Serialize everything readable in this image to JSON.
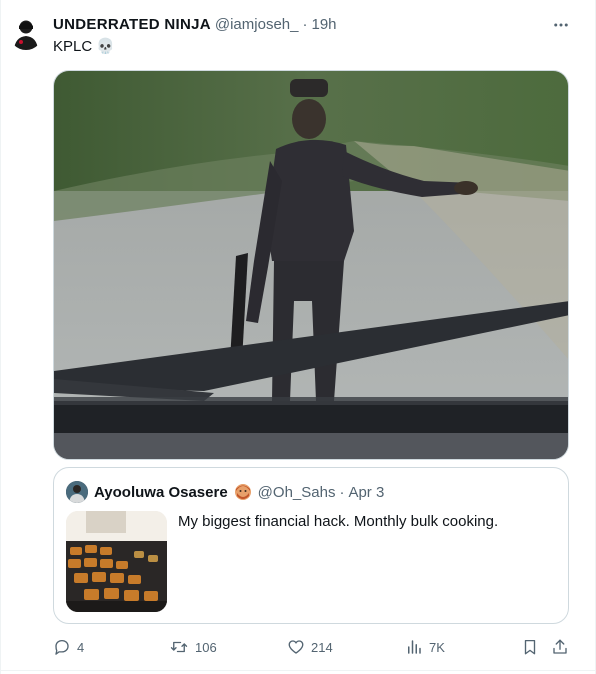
{
  "tweet": {
    "name": "UNDERRATED NINJA",
    "handle": "@iamjoseh_",
    "separator": "·",
    "time": "19h",
    "text": "KPLC",
    "emoji": "💀"
  },
  "media": {
    "alt": "Police officer pointing at the road, seen through a car windshield",
    "wiper_color": "#2b2e33"
  },
  "quote": {
    "name": "Ayooluwa Osasere",
    "handle": "@Oh_Sahs",
    "separator": "·",
    "date": "Apr 3",
    "text": "My biggest financial hack. Monthly bulk cooking."
  },
  "actions": {
    "replies": "4",
    "retweets": "106",
    "likes": "214",
    "views": "7K"
  },
  "icons": {
    "more": "more-icon",
    "reply": "reply-icon",
    "retweet": "retweet-icon",
    "like": "like-icon",
    "views": "views-icon",
    "bookmark": "bookmark-icon",
    "share": "share-icon"
  },
  "colors": {
    "text": "#0f1419",
    "secondary": "#536471",
    "border": "#cfd9de"
  }
}
